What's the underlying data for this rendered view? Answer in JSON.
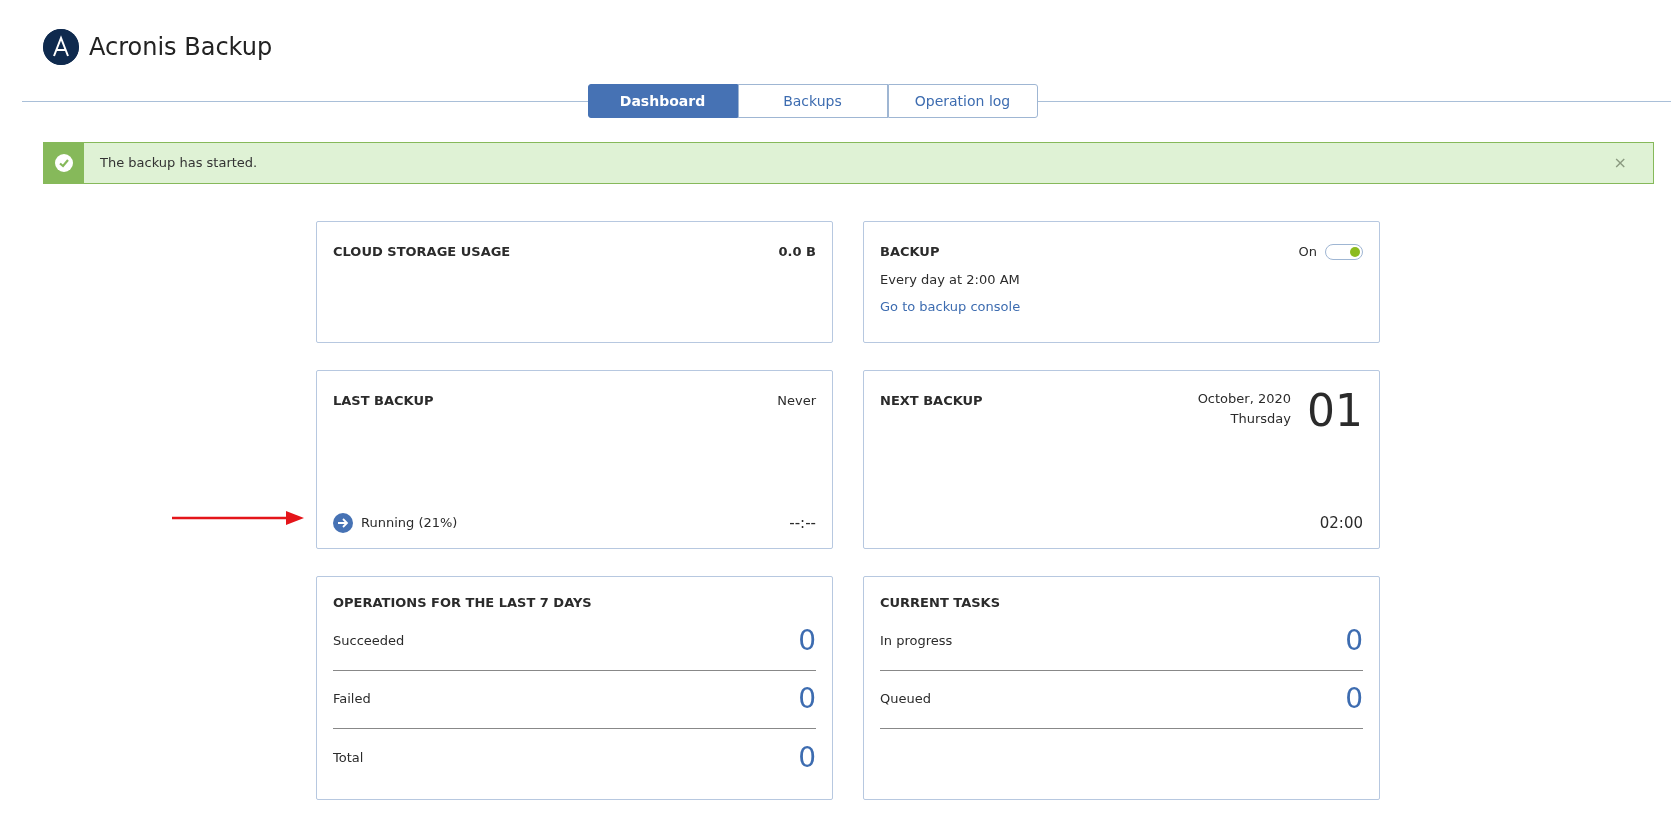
{
  "app": {
    "title": "Acronis Backup"
  },
  "tabs": [
    {
      "label": "Dashboard",
      "selected": true
    },
    {
      "label": "Backups",
      "selected": false
    },
    {
      "label": "Operation log",
      "selected": false
    }
  ],
  "alert": {
    "message": "The backup has started.",
    "close": "×"
  },
  "cloud_storage": {
    "title": "CLOUD STORAGE USAGE",
    "value": "0.0 B"
  },
  "backup": {
    "title": "BACKUP",
    "toggle_label": "On",
    "on": true,
    "schedule": "Every day at 2:00 AM",
    "link": "Go to backup console"
  },
  "last_backup": {
    "title": "LAST BACKUP",
    "value": "Never",
    "status": "Running (21%)",
    "time": "--:--"
  },
  "next_backup": {
    "title": "NEXT BACKUP",
    "month": "October, 2020",
    "weekday": "Thursday",
    "day": "01",
    "time": "02:00"
  },
  "operations": {
    "title": "OPERATIONS FOR THE LAST 7 DAYS",
    "rows": [
      {
        "label": "Succeeded",
        "count": "0"
      },
      {
        "label": "Failed",
        "count": "0"
      },
      {
        "label": "Total",
        "count": "0"
      }
    ]
  },
  "current_tasks": {
    "title": "CURRENT TASKS",
    "rows": [
      {
        "label": "In progress",
        "count": "0"
      },
      {
        "label": "Queued",
        "count": "0"
      }
    ]
  }
}
